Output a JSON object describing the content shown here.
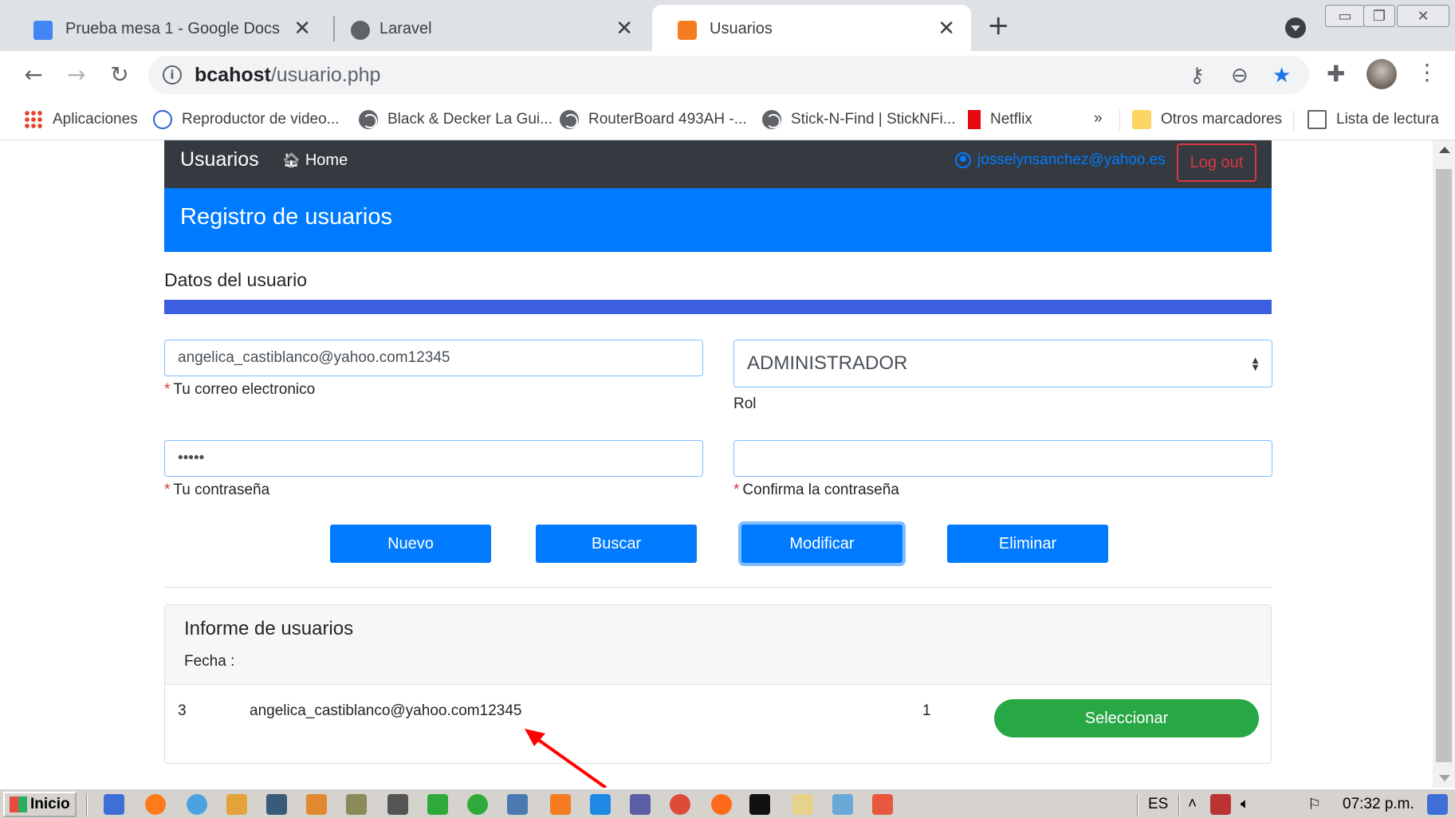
{
  "browser": {
    "tabs": [
      {
        "title": "Prueba mesa 1 - Google Docs",
        "icon": "google-docs-icon",
        "active": false
      },
      {
        "title": "Laravel",
        "icon": "globe-icon",
        "active": false
      },
      {
        "title": "Usuarios",
        "icon": "xampp-icon",
        "active": true
      }
    ],
    "new_tab": "+",
    "close": "✕",
    "url_host": "bcahost",
    "url_path": "/usuario.php"
  },
  "bookmarks": [
    {
      "label": "Aplicaciones",
      "icon": "apps-grid-icon"
    },
    {
      "label": "Reproductor de video...",
      "icon": "player-icon"
    },
    {
      "label": "Black & Decker La Gui...",
      "icon": "globe-icon"
    },
    {
      "label": "RouterBoard 493AH -...",
      "icon": "globe-icon"
    },
    {
      "label": "Stick-N-Find | StickNFi...",
      "icon": "globe-icon"
    },
    {
      "label": "Netflix",
      "icon": "netflix-icon"
    },
    {
      "label": "Otros marcadores",
      "icon": "folder-icon"
    },
    {
      "label": "Lista de lectura",
      "icon": "reading-list-icon"
    }
  ],
  "bookmarks_overflow": "»",
  "app": {
    "brand": "Usuarios",
    "home": "Home",
    "user_email": "josselynsanchez@yahoo.es",
    "logout": "Log out",
    "header": "Registro de usuarios",
    "section_title": "Datos del usuario"
  },
  "form": {
    "email_value": "angelica_castiblanco@yahoo.com12345",
    "email_help": "Tu correo electronico",
    "role_value": "ADMINISTRADOR",
    "role_help": "Rol",
    "password_value": "•••••",
    "password_help": "Tu contraseña",
    "confirm_value": "",
    "confirm_help": "Confirma la contraseña",
    "required_mark": "*"
  },
  "buttons": {
    "new": "Nuevo",
    "search": "Buscar",
    "modify": "Modificar",
    "delete": "Eliminar"
  },
  "report": {
    "title": "Informe de usuarios",
    "date_label": "Fecha :",
    "rows": [
      {
        "id": "3",
        "email": "angelica_castiblanco@yahoo.com12345",
        "role": "1",
        "action": "Seleccionar"
      }
    ]
  },
  "taskbar": {
    "start": "Inicio",
    "lang": "ES",
    "time": "07:32 p.m."
  },
  "colors": {
    "primary": "#007bff",
    "danger": "#dc3545",
    "success": "#28a745",
    "dark": "#343a40",
    "section_bar": "#3b5fe0",
    "annotation_arrow": "#ff0000"
  }
}
